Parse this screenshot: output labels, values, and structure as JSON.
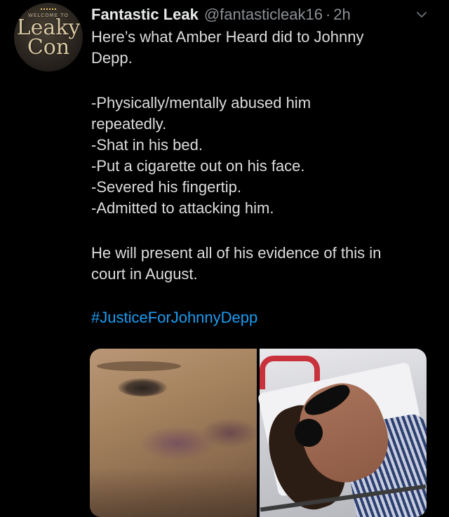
{
  "tweet": {
    "avatar": {
      "top_text": "WELCOME TO",
      "name_line1": "Leaky",
      "name_line2": "Con"
    },
    "author": {
      "display_name": "Fantastic Leak",
      "handle": "@fantasticleak16",
      "separator": "·",
      "time": "2h"
    },
    "menu_icon": "chevron-down-icon",
    "text": {
      "intro_line1": "Here’s what Amber Heard did to Johnny",
      "intro_line2": "Depp.",
      "list": [
        "-Physically/mentally abused him",
        "repeatedly.",
        "-Shat in his bed.",
        "-Put a cigarette out on his face.",
        "-Severed his fingertip.",
        "-Admitted to attacking him."
      ],
      "closing_line1": "He will present all of his evidence of this in",
      "closing_line2": "court in August.",
      "hashtag": "#JusticeForJohnnyDepp"
    },
    "media_count": 2
  },
  "colors": {
    "background": "#000000",
    "text": "#dddddd",
    "muted": "#8b8f94",
    "link": "#1d9bf0"
  }
}
